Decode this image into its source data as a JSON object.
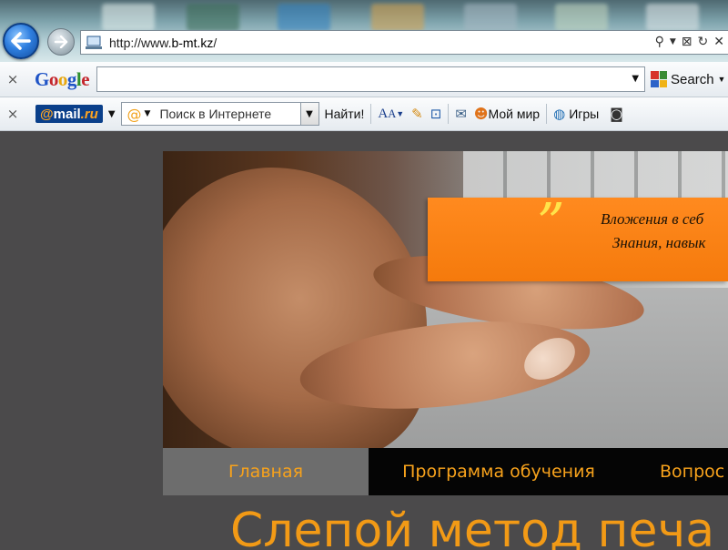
{
  "browser": {
    "url_prefix": "http://www.",
    "url_domain": "b-mt.kz",
    "url_suffix": "/"
  },
  "google_toolbar": {
    "close": "×",
    "logo": "Google",
    "search_value": "",
    "search_button": "Search"
  },
  "mail_toolbar": {
    "close": "×",
    "logo_at": "@",
    "logo_mail": "mail",
    "logo_ru": ".ru",
    "search_placeholder": "Поиск в Интернете",
    "find_button": "Найти!",
    "my_world": "Мой мир",
    "games": "Игры"
  },
  "hero": {
    "quote_mark": "”",
    "quote_line1": "Вложения в себ",
    "quote_line2": "Знания, навык"
  },
  "nav": {
    "items": [
      {
        "label": "Главная",
        "active": true
      },
      {
        "label": "Программа обучения",
        "active": false
      },
      {
        "label": "Вопрос",
        "active": false
      }
    ]
  },
  "page": {
    "heading": "Слепой метод печа"
  },
  "colors": {
    "accent_orange": "#f29a16",
    "nav_bg": "#050505",
    "page_bg": "#4b4a4b",
    "quote_box": "#ff8a1f"
  }
}
